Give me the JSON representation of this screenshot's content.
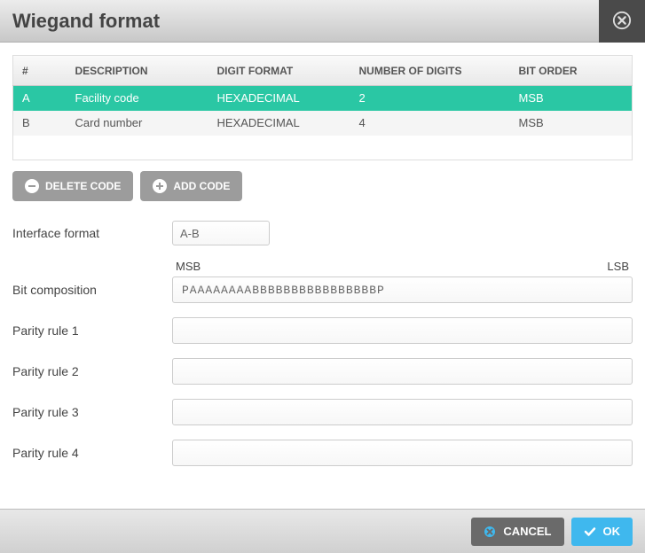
{
  "header": {
    "title": "Wiegand format"
  },
  "table": {
    "headers": {
      "num": "#",
      "desc": "DESCRIPTION",
      "fmt": "DIGIT FORMAT",
      "digits": "NUMBER OF DIGITS",
      "order": "BIT ORDER"
    },
    "rows": [
      {
        "num": "A",
        "desc": "Facility code",
        "fmt": "HEXADECIMAL",
        "digits": "2",
        "order": "MSB"
      },
      {
        "num": "B",
        "desc": "Card number",
        "fmt": "HEXADECIMAL",
        "digits": "4",
        "order": "MSB"
      }
    ]
  },
  "buttons": {
    "delete": "DELETE CODE",
    "add": "ADD CODE"
  },
  "form": {
    "interface_label": "Interface format",
    "interface_value": "A-B",
    "msb": "MSB",
    "lsb": "LSB",
    "bitcomp_label": "Bit composition",
    "bitcomp_value": "PAAAAAAAABBBBBBBBBBBBBBBBP",
    "parity1_label": "Parity rule 1",
    "parity1_value": "",
    "parity2_label": "Parity rule 2",
    "parity2_value": "",
    "parity3_label": "Parity rule 3",
    "parity3_value": "",
    "parity4_label": "Parity rule 4",
    "parity4_value": ""
  },
  "footer": {
    "cancel": "CANCEL",
    "ok": "OK"
  }
}
